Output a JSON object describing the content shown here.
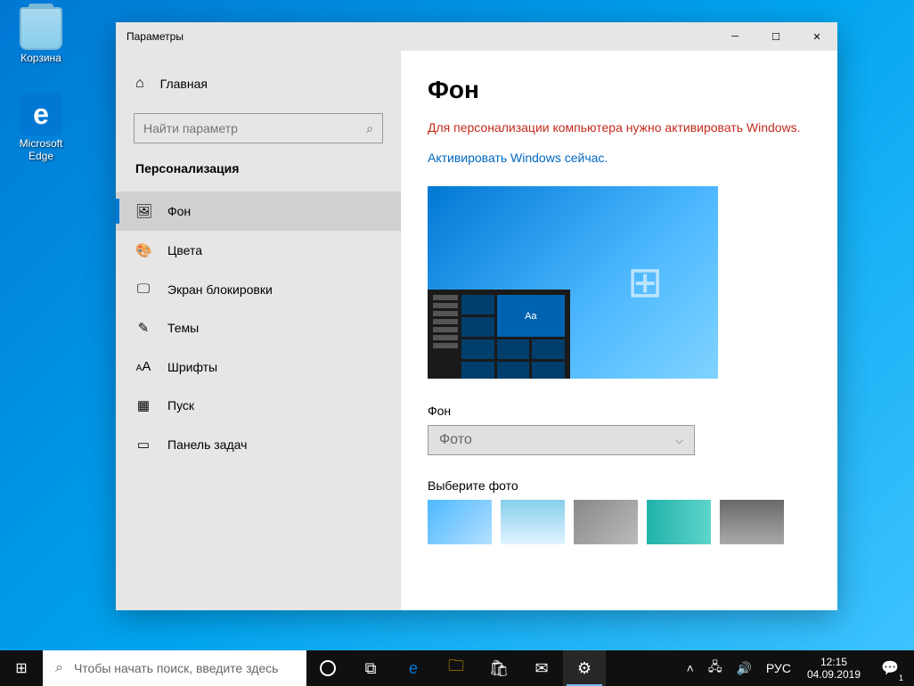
{
  "desktop": {
    "recycle_bin": "Корзина",
    "edge": "Microsoft Edge"
  },
  "window": {
    "title": "Параметры"
  },
  "sidebar": {
    "home": "Главная",
    "search_placeholder": "Найти параметр",
    "category": "Персонализация",
    "items": [
      {
        "label": "Фон"
      },
      {
        "label": "Цвета"
      },
      {
        "label": "Экран блокировки"
      },
      {
        "label": "Темы"
      },
      {
        "label": "Шрифты"
      },
      {
        "label": "Пуск"
      },
      {
        "label": "Панель задач"
      }
    ]
  },
  "content": {
    "heading": "Фон",
    "warning": "Для персонализации компьютера нужно активировать Windows.",
    "activate_link": "Активировать Windows сейчас.",
    "preview_tile_text": "Aa",
    "bg_label": "Фон",
    "bg_dropdown": "Фото",
    "choose_label": "Выберите фото"
  },
  "taskbar": {
    "search_placeholder": "Чтобы начать поиск, введите здесь",
    "lang": "РУС",
    "time": "12:15",
    "date": "04.09.2019",
    "notif_count": "1"
  }
}
